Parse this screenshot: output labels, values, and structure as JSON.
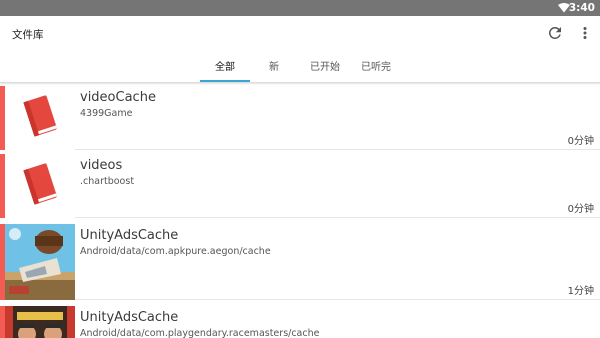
{
  "status": {
    "time": "3:40",
    "wifi_icon": "wifi-icon"
  },
  "header": {
    "title": "文件库",
    "refresh_icon": "refresh-icon",
    "menu_icon": "more-vert-icon"
  },
  "tabs": [
    {
      "label": "全部",
      "active": true
    },
    {
      "label": "新",
      "active": false
    },
    {
      "label": "已开始",
      "active": false
    },
    {
      "label": "已听完",
      "active": false
    }
  ],
  "colors": {
    "accent": "#3aa6d6",
    "bookmark": "#f25c55",
    "statusbar": "#757575"
  },
  "items": [
    {
      "name": "videoCache",
      "path": "4399Game",
      "duration": "0分钟",
      "thumb": "book-icon"
    },
    {
      "name": "videos",
      "path": ".chartboost",
      "duration": "0分钟",
      "thumb": "book-icon"
    },
    {
      "name": "UnityAdsCache",
      "path": "Android/data/com.apkpure.aegon/cache",
      "duration": "1分钟",
      "thumb": "game-cover-image"
    },
    {
      "name": "UnityAdsCache",
      "path": "Android/data/com.playgendary.racemasters/cache",
      "duration": "",
      "thumb": "game-cover-image"
    }
  ]
}
